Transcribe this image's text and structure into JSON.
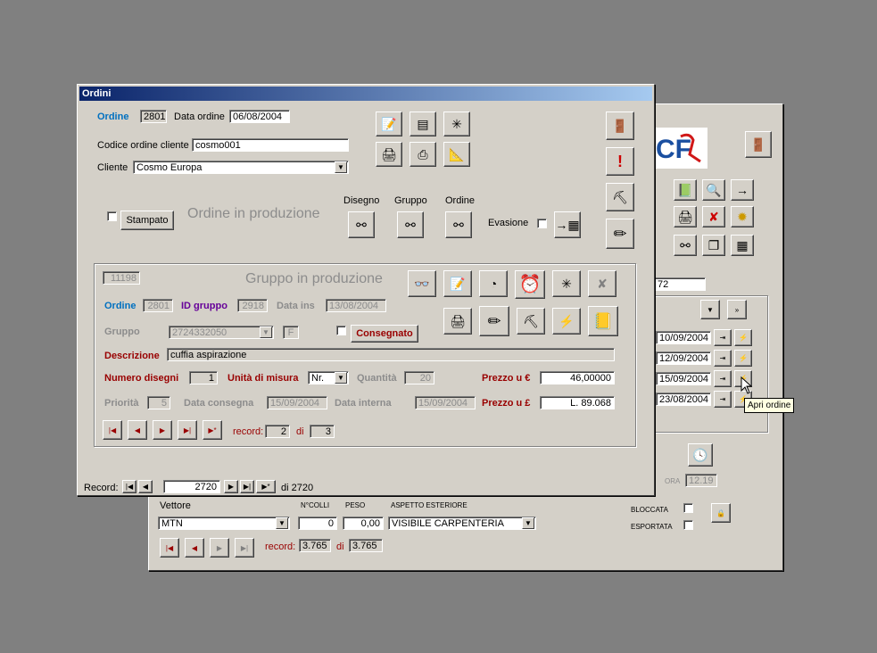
{
  "back_window": {
    "date_rows": [
      "10/09/2004",
      "12/09/2004",
      "15/09/2004",
      "23/08/2004"
    ],
    "field_72": "72",
    "ora_label": "ORA",
    "ora_value": "12.19",
    "vettore_label": "Vettore",
    "vettore_value": "MTN",
    "ncolli_label": "N°COLLI",
    "ncolli_value": "0",
    "peso_label": "PESO",
    "peso_value": "0,00",
    "aspetto_label": "ASPETTO ESTERIORE",
    "aspetto_value": "VISIBILE CARPENTERIA",
    "bloccata_label": "BLOCCATA",
    "esportata_label": "ESPORTATA",
    "record_label": "record:",
    "record_value": "3.765",
    "di_label": "di",
    "record_total": "3.765",
    "tooltip": "Apri ordine",
    "logo_text": "CF"
  },
  "front_window": {
    "title": "Ordini",
    "ordine_label": "Ordine",
    "ordine_value": "2801",
    "data_ordine_label": "Data ordine",
    "data_ordine_value": "06/08/2004",
    "codice_label": "Codice ordine cliente",
    "codice_value": "cosmo001",
    "cliente_label": "Cliente",
    "cliente_value": "Cosmo Europa",
    "stampato_label": "Stampato",
    "ordine_prod_label": "Ordine in produzione",
    "disegno_label": "Disegno",
    "gruppo_label": "Gruppo",
    "ordine_col_label": "Ordine",
    "evasione_label": "Evasione",
    "record_label": "Record:",
    "record_value": "2720",
    "record_total": "di 2720"
  },
  "group_panel": {
    "id_value": "11198",
    "title": "Gruppo in produzione",
    "ordine_label": "Ordine",
    "ordine_value": "2801",
    "id_gruppo_label": "ID gruppo",
    "id_gruppo_value": "2918",
    "data_ins_label": "Data ins",
    "data_ins_value": "13/08/2004",
    "gruppo_label": "Gruppo",
    "gruppo_value": "2724332050",
    "f_label": "F",
    "consegnato_label": "Consegnato",
    "descrizione_label": "Descrizione",
    "descrizione_value": "cuffia aspirazione",
    "numero_disegni_label": "Numero disegni",
    "numero_disegni_value": "1",
    "unita_label": "Unità di misura",
    "unita_value": "Nr.",
    "quantita_label": "Quantità",
    "quantita_value": "20",
    "prezzo_euro_label": "Prezzo u €",
    "prezzo_euro_value": "46,00000",
    "priorita_label": "Priorità",
    "priorita_value": "5",
    "data_consegna_label": "Data consegna",
    "data_consegna_value": "15/09/2004",
    "data_interna_label": "Data interna",
    "data_interna_value": "15/09/2004",
    "prezzo_lire_label": "Prezzo u £",
    "prezzo_lire_value": "L. 89.068",
    "record_label": "record:",
    "record_value": "2",
    "di_label": "di",
    "record_total": "3"
  },
  "colors": {
    "title_start": "#0a246a",
    "title_end": "#a6caf0",
    "label_blue": "#0070c0",
    "label_purple": "#660099",
    "label_red": "#990000"
  }
}
